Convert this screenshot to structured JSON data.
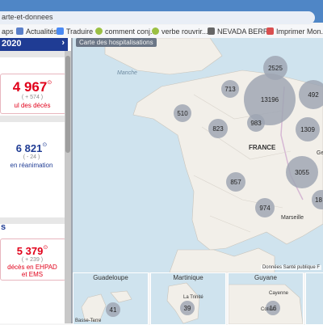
{
  "browser": {
    "url": "arte-et-donnees",
    "bookmarks": [
      {
        "label": "aps",
        "icon": "page-icon",
        "color": "#999999"
      },
      {
        "label": "Actualités",
        "icon": "news-icon",
        "color": "#5a7fc9"
      },
      {
        "label": "Traduire",
        "icon": "translate-icon",
        "color": "#4a8af4"
      },
      {
        "label": "comment conj...",
        "icon": "site-icon",
        "color": "#9bc043"
      },
      {
        "label": "verbe rouvrir...",
        "icon": "site-icon",
        "color": "#9bc043"
      },
      {
        "label": "NEVADA BERRY",
        "icon": "site-icon",
        "color": "#666666"
      },
      {
        "label": "Imprimer Mon...",
        "icon": "print-icon",
        "color": "#d94f4f"
      }
    ]
  },
  "sidebar": {
    "header_year": "2020",
    "header_chevron": "›",
    "deaths_value": "4 967",
    "deaths_delta": "( + 574 )",
    "deaths_label": "ul des décès",
    "reanimation_value": "6 821",
    "reanimation_delta": "( - 24 )",
    "reanimation_label": "en réanimation",
    "ehpad_value": "5 379",
    "ehpad_delta": "( + 239 )",
    "ehpad_label": "décès en EHPAD et EMS",
    "section_letter": "s",
    "info_marker": "⊙"
  },
  "map": {
    "title": "Carte des hospitalisations",
    "source": "Données Santé publique F",
    "labels": {
      "france": "FRANCE",
      "manche": "Manche",
      "marseille": "Marseille",
      "germany_partial": "Ge"
    },
    "bubbles": [
      {
        "value": "2525"
      },
      {
        "value": "713"
      },
      {
        "value": "13196"
      },
      {
        "value": "492"
      },
      {
        "value": "510"
      },
      {
        "value": "823"
      },
      {
        "value": "983"
      },
      {
        "value": "1309"
      },
      {
        "value": "3055"
      },
      {
        "value": "857"
      },
      {
        "value": "974"
      },
      {
        "value": "18"
      }
    ]
  },
  "overseas": [
    {
      "name": "Guadeloupe",
      "value": "41",
      "place": "Basse-Terre"
    },
    {
      "name": "Martinique",
      "value": "39",
      "place": "La Trinité"
    },
    {
      "name": "Guyane",
      "value": "16",
      "place": "Cayenne",
      "place2": "Cotica"
    }
  ],
  "colors": {
    "accent": "#1f3c94",
    "alert": "#e1001a",
    "bubble": "#9da5b2",
    "sea": "#cfe3ee",
    "land": "#f2efe9"
  }
}
